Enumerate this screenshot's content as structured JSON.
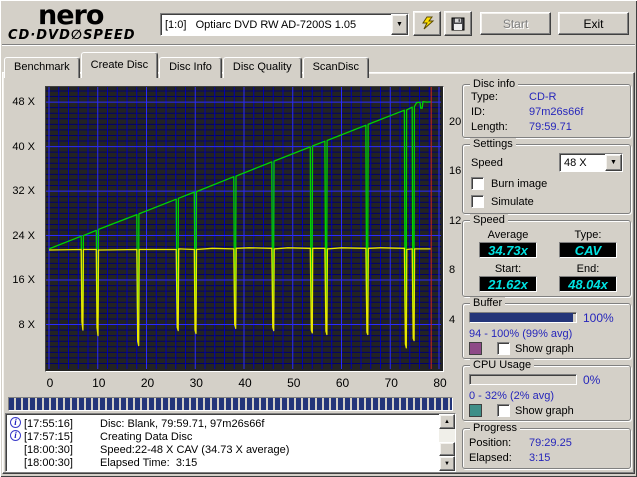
{
  "header": {
    "logo_top": "nero",
    "logo_bottom_left": "CD·DVD",
    "logo_disc_glyph": "∅",
    "logo_bottom_right": "SPEED",
    "drive_selector_value": "[1:0]   Optiarc DVD RW AD-7200S 1.05",
    "dropdown_arrow": "▼",
    "icons": [
      "lightning-icon",
      "save-icon"
    ],
    "start_label": "Start",
    "exit_label": "Exit"
  },
  "tabs": {
    "active": "Create Disc",
    "items": [
      {
        "label": "Benchmark"
      },
      {
        "label": "Create Disc"
      },
      {
        "label": "Disc Info"
      },
      {
        "label": "Disc Quality"
      },
      {
        "label": "ScanDisc"
      }
    ]
  },
  "chart_data": {
    "type": "line",
    "x_axis": {
      "range": [
        0,
        80
      ],
      "ticks": [
        {
          "t": 0,
          "label": "0"
        },
        {
          "t": 10,
          "label": "10"
        },
        {
          "t": 20,
          "label": "20"
        },
        {
          "t": 30,
          "label": "30"
        },
        {
          "t": 40,
          "label": "40"
        },
        {
          "t": 50,
          "label": "50"
        },
        {
          "t": 60,
          "label": "60"
        },
        {
          "t": 70,
          "label": "70"
        },
        {
          "t": 80,
          "label": "80"
        }
      ]
    },
    "left_axis": {
      "range": [
        0,
        50.7
      ],
      "ticks": [
        {
          "v": 8,
          "label": "8 X"
        },
        {
          "v": 16,
          "label": "16 X"
        },
        {
          "v": 24,
          "label": "24 X"
        },
        {
          "v": 32,
          "label": "32 X"
        },
        {
          "v": 40,
          "label": "40 X"
        },
        {
          "v": 48,
          "label": "48 X"
        }
      ]
    },
    "right_axis": {
      "range": [
        0,
        22.8
      ],
      "ticks": [
        {
          "v": 4,
          "label": "4"
        },
        {
          "v": 8,
          "label": "8"
        },
        {
          "v": 12,
          "label": "12"
        },
        {
          "v": 16,
          "label": "16"
        },
        {
          "v": 20,
          "label": "20"
        }
      ]
    },
    "position_marker": {
      "t": 78.4,
      "color": "#cc2222"
    },
    "colors": {
      "bg": "#232323",
      "grid_minor_h": "#00006e",
      "grid_minor_v": "#0000b2",
      "grid_major": "#2b2bff"
    },
    "series": [
      {
        "name": "write-speed",
        "color": "#00d300",
        "axis": "left",
        "points": [
          [
            0,
            21.6
          ],
          [
            6.6,
            23.88
          ],
          [
            6.75,
            12
          ],
          [
            6.95,
            9.8
          ],
          [
            7.05,
            24.0
          ],
          [
            9.7,
            24.93
          ],
          [
            9.85,
            12
          ],
          [
            10.05,
            9.2
          ],
          [
            10.15,
            25.1
          ],
          [
            18.0,
            27.77
          ],
          [
            18.15,
            11
          ],
          [
            18.35,
            7.4
          ],
          [
            18.45,
            27.9
          ],
          [
            26.1,
            30.54
          ],
          [
            26.25,
            12
          ],
          [
            26.45,
            9.6
          ],
          [
            26.55,
            30.7
          ],
          [
            29.8,
            31.81
          ],
          [
            29.95,
            13
          ],
          [
            30.15,
            10.0
          ],
          [
            30.25,
            31.9
          ],
          [
            37.9,
            34.58
          ],
          [
            38.05,
            14
          ],
          [
            38.25,
            11.4
          ],
          [
            38.35,
            34.7
          ],
          [
            45.7,
            37.24
          ],
          [
            45.85,
            14
          ],
          [
            46.05,
            11.0
          ],
          [
            46.15,
            37.4
          ],
          [
            53.6,
            39.94
          ],
          [
            53.75,
            13
          ],
          [
            53.95,
            10.5
          ],
          [
            54.05,
            40.1
          ],
          [
            56.6,
            40.97
          ],
          [
            56.75,
            13
          ],
          [
            56.95,
            10.0
          ],
          [
            57.05,
            41.1
          ],
          [
            65.0,
            43.84
          ],
          [
            65.15,
            12
          ],
          [
            65.35,
            8.7
          ],
          [
            65.45,
            44.0
          ],
          [
            72.9,
            46.54
          ],
          [
            73.05,
            10
          ],
          [
            73.25,
            6.4
          ],
          [
            73.35,
            46.6
          ],
          [
            74.5,
            47.09
          ],
          [
            74.65,
            11
          ],
          [
            74.85,
            8.3
          ],
          [
            74.95,
            47.2
          ],
          [
            75.4,
            47.9
          ],
          [
            76.1,
            48.0
          ],
          [
            76.25,
            46.9
          ],
          [
            76.55,
            46.9
          ],
          [
            76.7,
            48.1
          ],
          [
            77.5,
            48.0
          ],
          [
            78.4,
            48.04
          ]
        ]
      },
      {
        "name": "secondary-speed",
        "color": "#e8e800",
        "axis": "left",
        "points": [
          [
            0,
            21.4
          ],
          [
            6.6,
            21.5
          ],
          [
            6.75,
            8.5
          ],
          [
            6.95,
            7.0
          ],
          [
            7.05,
            21.5
          ],
          [
            9.7,
            21.5
          ],
          [
            9.85,
            7.5
          ],
          [
            10.05,
            6.0
          ],
          [
            10.15,
            21.4
          ],
          [
            18.0,
            21.5
          ],
          [
            18.2,
            5.0
          ],
          [
            18.4,
            4.2
          ],
          [
            18.5,
            21.5
          ],
          [
            26.1,
            21.5
          ],
          [
            26.3,
            7.5
          ],
          [
            26.5,
            6.9
          ],
          [
            26.6,
            21.6
          ],
          [
            29.8,
            21.5
          ],
          [
            29.95,
            7.0
          ],
          [
            30.15,
            6.4
          ],
          [
            30.25,
            21.5
          ],
          [
            33.5,
            21.7
          ],
          [
            37.9,
            21.6
          ],
          [
            38.1,
            8.0
          ],
          [
            38.3,
            7.3
          ],
          [
            38.4,
            21.7
          ],
          [
            41.0,
            21.8
          ],
          [
            45.7,
            21.7
          ],
          [
            45.9,
            7.5
          ],
          [
            46.1,
            6.9
          ],
          [
            46.2,
            21.6
          ],
          [
            49.0,
            21.8
          ],
          [
            53.6,
            21.7
          ],
          [
            53.8,
            7.0
          ],
          [
            54.0,
            6.5
          ],
          [
            54.1,
            21.7
          ],
          [
            56.6,
            21.7
          ],
          [
            56.8,
            6.8
          ],
          [
            57.0,
            6.2
          ],
          [
            57.1,
            21.6
          ],
          [
            60.0,
            21.8
          ],
          [
            65.0,
            21.7
          ],
          [
            65.2,
            6.6
          ],
          [
            65.4,
            6.2
          ],
          [
            65.5,
            21.7
          ],
          [
            68.0,
            21.8
          ],
          [
            72.9,
            21.7
          ],
          [
            73.1,
            4.5
          ],
          [
            73.3,
            3.8
          ],
          [
            73.4,
            21.5
          ],
          [
            74.5,
            21.6
          ],
          [
            74.7,
            5.5
          ],
          [
            74.9,
            5.1
          ],
          [
            75.0,
            21.6
          ],
          [
            78.3,
            21.6
          ]
        ]
      }
    ]
  },
  "write_progress_bar": {
    "fill_percent": 100
  },
  "log": {
    "items": [
      {
        "icon": "info-icon",
        "time": "[17:55:16]",
        "text": "Disc: Blank, 79:59.71, 97m26s66f"
      },
      {
        "icon": "info-icon",
        "time": "[17:57:15]",
        "text": "Creating Data Disc"
      },
      {
        "icon": null,
        "time": "[18:00:30]",
        "text": "Speed:22-48 X CAV (34.73 X average)"
      },
      {
        "icon": null,
        "time": "[18:00:30]",
        "text": "Elapsed Time:  3:15"
      }
    ],
    "scrollbar": {
      "up_glyph": "▲",
      "down_glyph": "▼"
    }
  },
  "disc_info": {
    "title": "Disc info",
    "type_label": "Type:",
    "type_value": "CD-R",
    "id_label": "ID:",
    "id_value": "97m26s66f",
    "length_label": "Length:",
    "length_value": "79:59.71"
  },
  "settings": {
    "title": "Settings",
    "speed_label": "Speed",
    "speed_value": "48 X",
    "burn_image_label": "Burn image",
    "burn_image_checked": false,
    "simulate_label": "Simulate",
    "simulate_checked": false
  },
  "speed": {
    "title": "Speed",
    "average_label": "Average",
    "average_value": "34.73x",
    "type_label": "Type:",
    "type_value": "CAV",
    "start_label": "Start:",
    "start_value": "21.62x",
    "end_label": "End:",
    "end_value": "48.04x"
  },
  "buffer": {
    "title": "Buffer",
    "percent": "100%",
    "range": "94 - 100% (99% avg)",
    "bar_fill_percent": 97,
    "bar_color": "#243579",
    "swatch_color": "#8e4a87",
    "show_graph_label": "Show graph",
    "show_graph_checked": false
  },
  "cpu": {
    "title": "CPU Usage",
    "percent": "0%",
    "range": "0 - 32% (2% avg)",
    "bar_fill_percent": 0,
    "bar_color": "#243579",
    "swatch_color": "#3f8f88",
    "show_graph_label": "Show graph",
    "show_graph_checked": false
  },
  "progress": {
    "title": "Progress",
    "position_label": "Position:",
    "position_value": "79:29.25",
    "elapsed_label": "Elapsed:",
    "elapsed_value": "3:15"
  }
}
